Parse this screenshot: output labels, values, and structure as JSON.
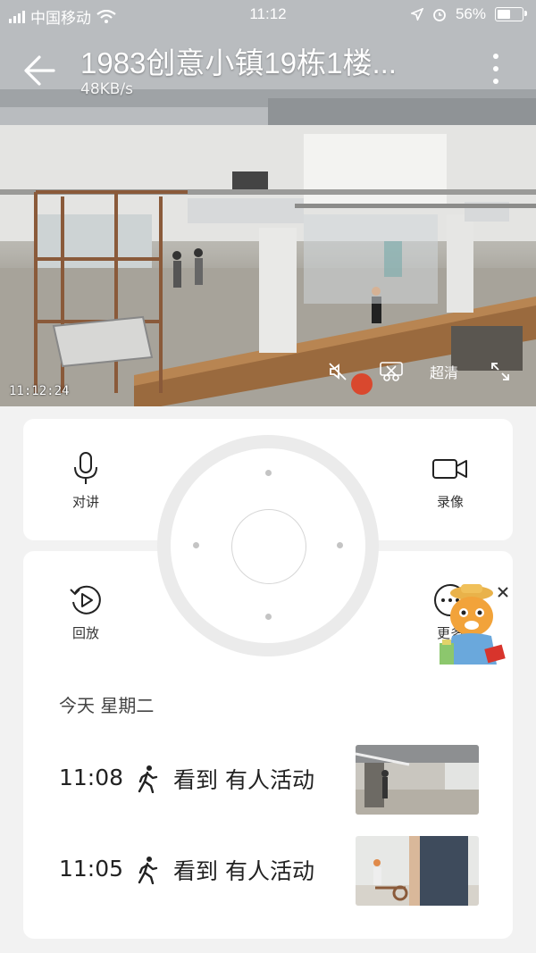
{
  "status_bar": {
    "carrier": "中国移动",
    "time": "11:12",
    "battery": "56%"
  },
  "header": {
    "title": "1983创意小镇19栋1楼...",
    "speed": "48KB/s"
  },
  "video": {
    "timestamp": "11:12:24",
    "quality_label": "超清"
  },
  "controls": {
    "talk_label": "对讲",
    "record_label": "录像",
    "playback_label": "回放",
    "more_label": "更多"
  },
  "events": {
    "day_label": "今天 星期二",
    "items": [
      {
        "time": "11:08",
        "text": "看到 有人活动"
      },
      {
        "time": "11:05",
        "text": "看到 有人活动"
      }
    ]
  },
  "colors": {
    "page_background": "#f2f2f2",
    "card_background": "#ffffff",
    "accent_orange": "#f2a33a"
  }
}
